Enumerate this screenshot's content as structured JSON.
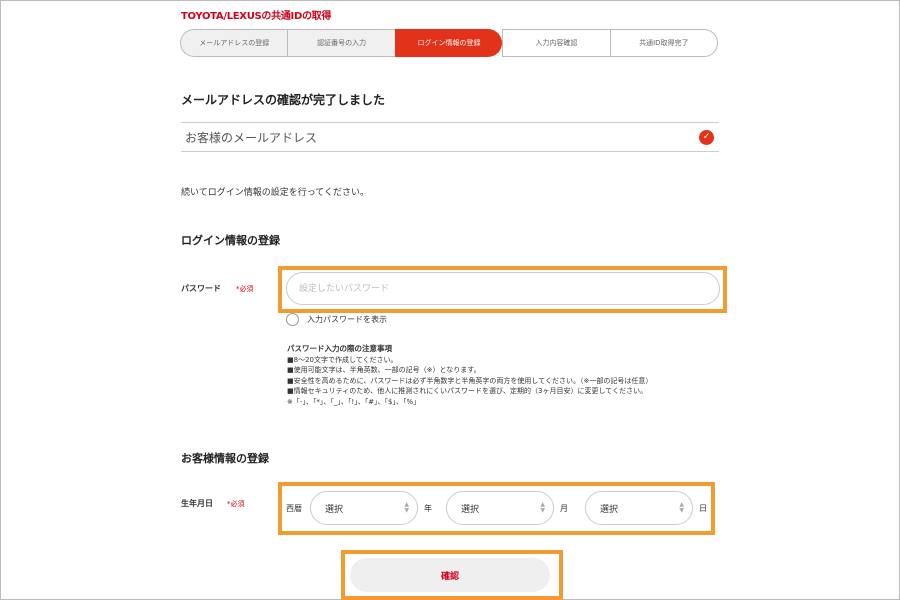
{
  "brand": "TOYOTA/LEXUSの共通IDの取得",
  "steps": [
    "メールアドレスの登録",
    "認証番号の入力",
    "ログイン情報の登録",
    "入力内容確認",
    "共通ID取得完了"
  ],
  "email_section": {
    "heading": "メールアドレスの確認が完了しました",
    "label": "お客様のメールアドレス",
    "status_icon": "check-icon"
  },
  "continue_text": "続いてログイン情報の設定を行ってください。",
  "login_section": {
    "heading": "ログイン情報の登録",
    "password_label": "パスワード",
    "required_mark": "*必須",
    "password_placeholder": "設定したいパスワード",
    "show_password_label": "入力パスワードを表示",
    "notes_title": "パスワード入力の際の注意事項",
    "notes": [
      "■8～20文字で作成してください。",
      "■使用可能文字は、半角英数、一部の記号（※）となります。",
      "■安全性を高めるために、パスワードは必ず半角数字と半角英字の両方を使用してください。（※一部の記号は任意）",
      "■情報セキュリティのため、他人に推測されにくいパスワードを選び、定期的（3ヶ月目安）に変更してください。",
      "※「-」、「*」、「_」、「!」、「#」、「$」、「%」"
    ]
  },
  "customer_section": {
    "heading": "お客様情報の登録",
    "birth_label": "生年月日",
    "required_mark": "*必須",
    "era_label": "西暦",
    "year_unit": "年",
    "month_unit": "月",
    "day_unit": "日",
    "select_text": "選択"
  },
  "confirm_button": "確認",
  "colors": {
    "accent": "#e2321a",
    "highlight": "#f29b2e"
  }
}
